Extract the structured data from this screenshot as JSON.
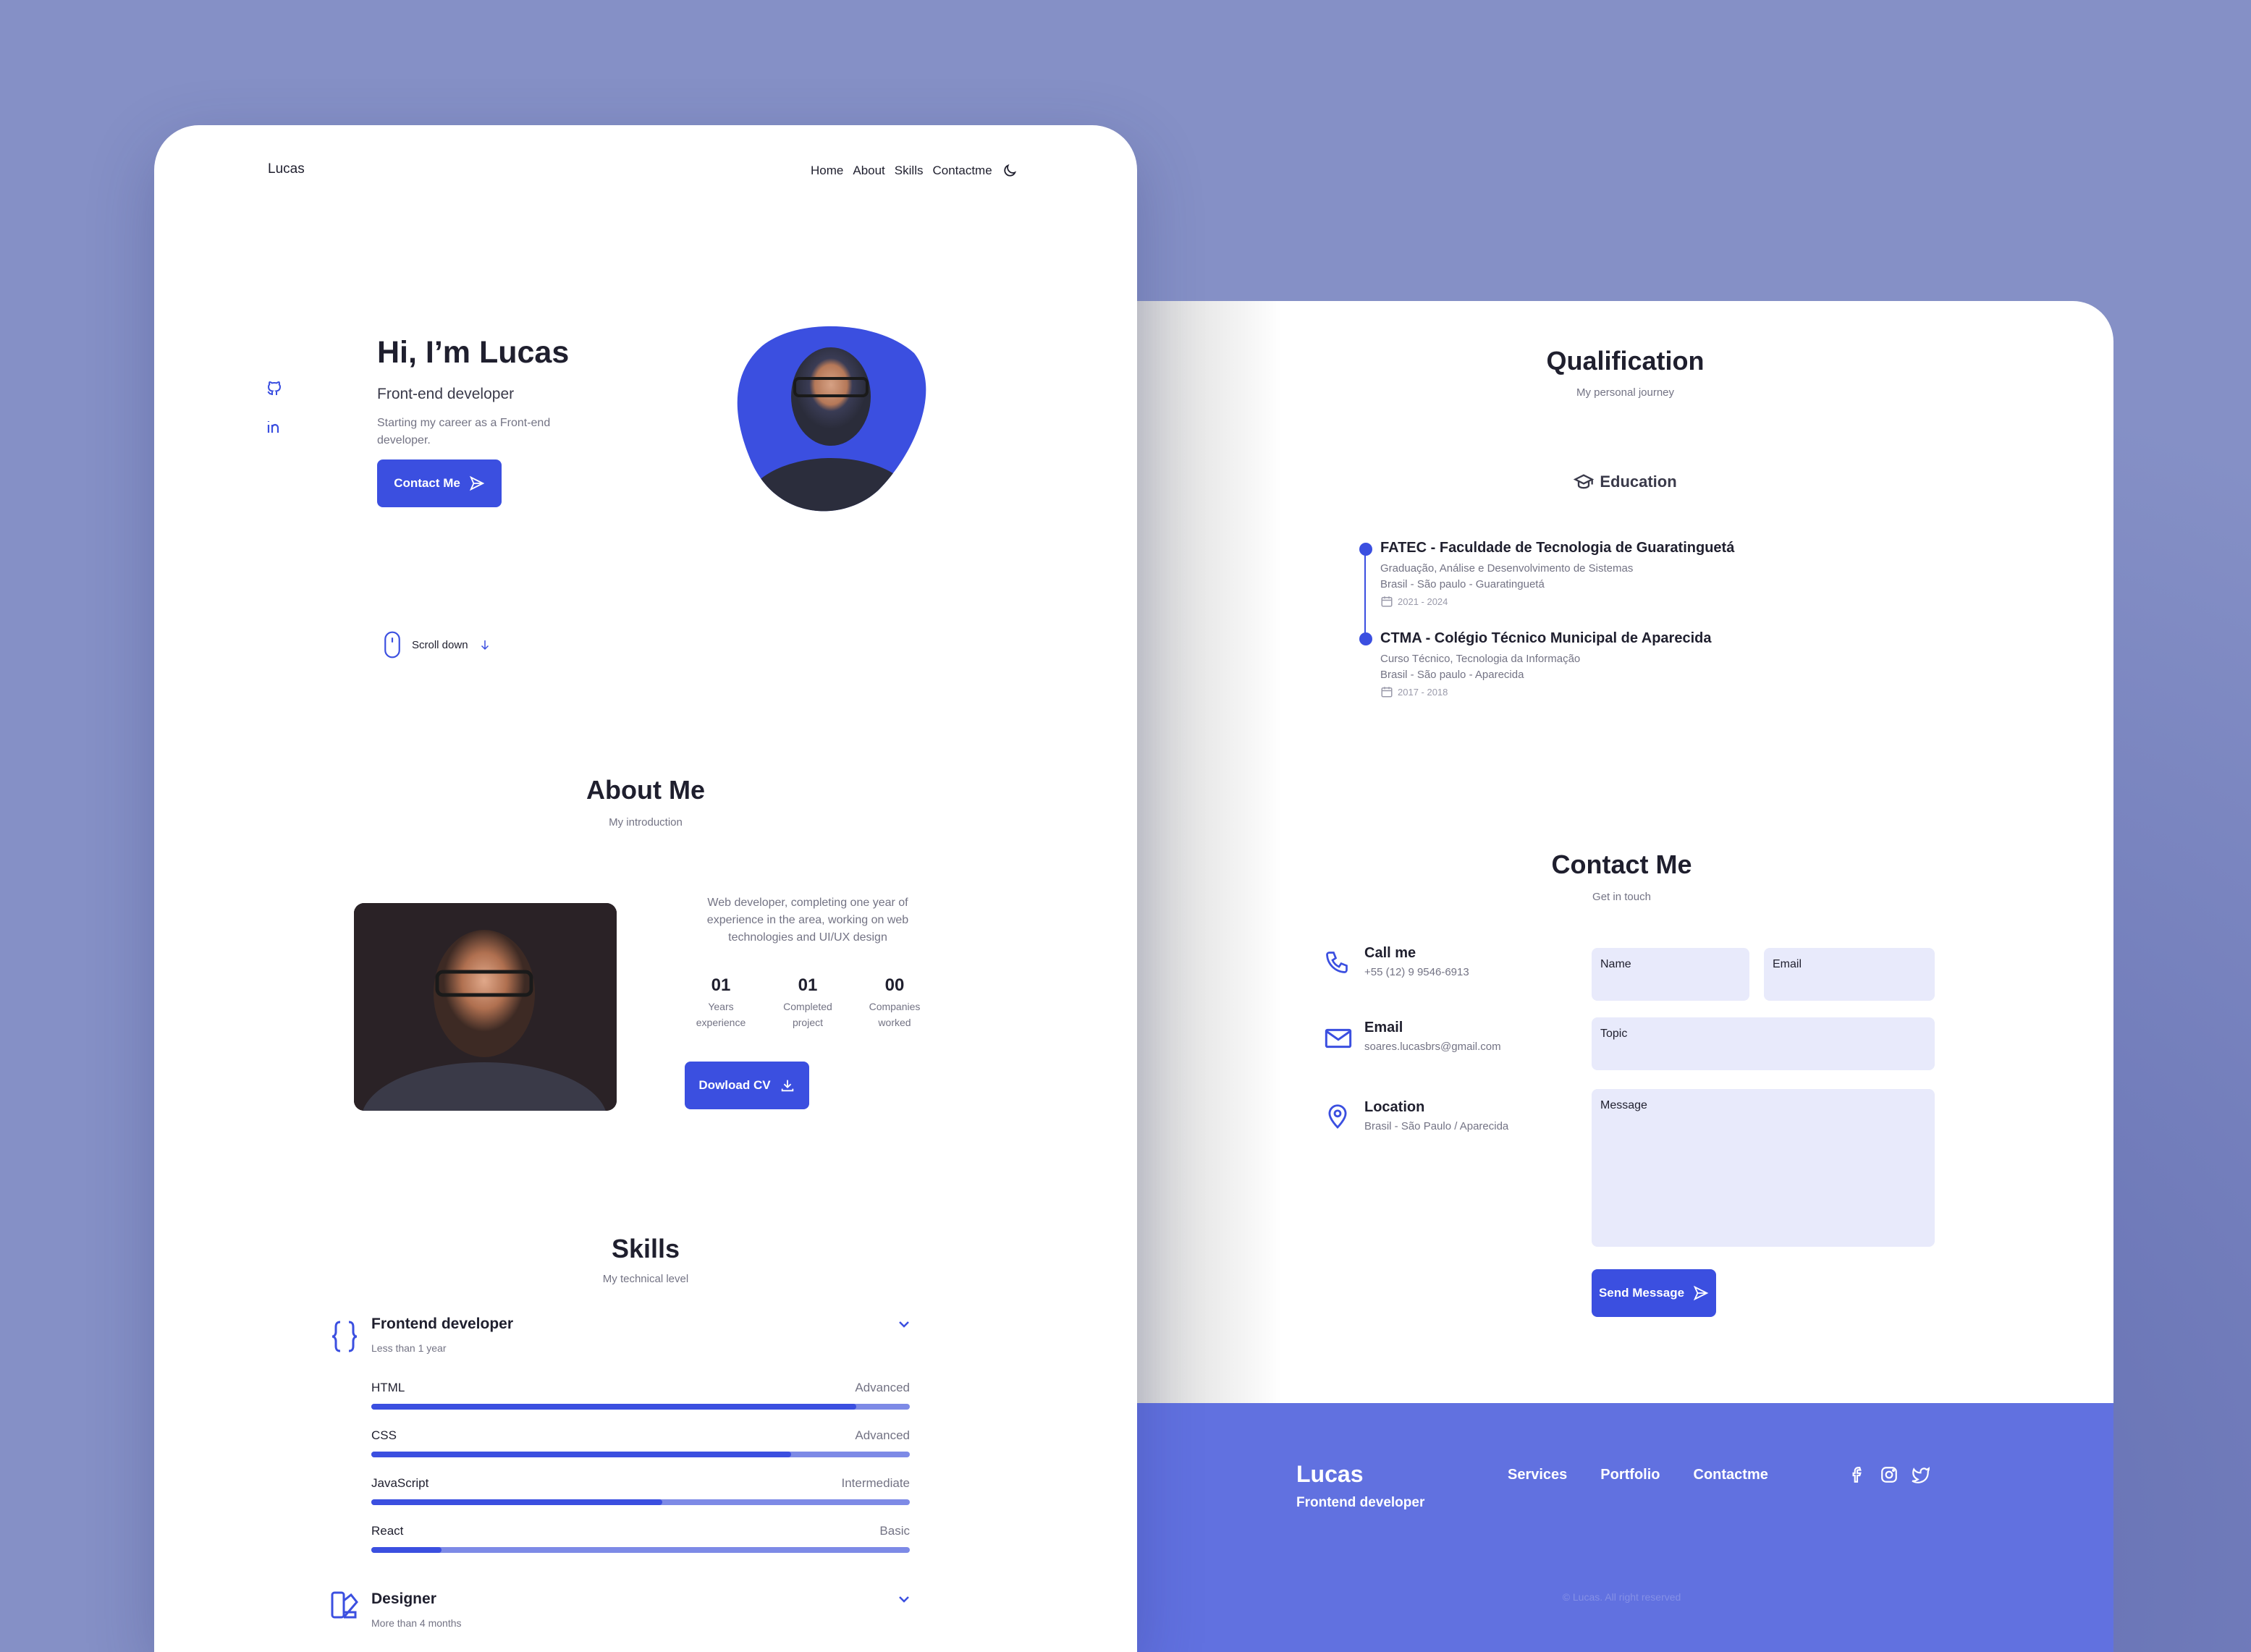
{
  "colors": {
    "accent": "#3b4fe0",
    "background": "#8590c6",
    "footer": "#6171e0",
    "input_bg": "#e8eafb"
  },
  "header": {
    "logo": "Lucas",
    "nav": [
      "Home",
      "About",
      "Skills",
      "Contactme"
    ],
    "theme_icon": "moon-icon"
  },
  "hero": {
    "title": "Hi, I’m Lucas",
    "subtitle": "Front-end developer",
    "description": "Starting my career as a Front-end developer.",
    "contact_button": "Contact Me",
    "scroll": "Scroll down",
    "social_icons": [
      "github-icon",
      "linkedin-icon"
    ]
  },
  "about": {
    "title": "About Me",
    "subtitle": "My introduction",
    "description": "Web developer, completing one year of experience in the area, working on web technologies and UI/UX design",
    "stats": [
      {
        "number": "01",
        "label1": "Years",
        "label2": "experience"
      },
      {
        "number": "01",
        "label1": "Completed",
        "label2": "project"
      },
      {
        "number": "00",
        "label1": "Companies",
        "label2": "worked"
      }
    ],
    "cv_button": "Dowload CV"
  },
  "skills": {
    "title": "Skills",
    "subtitle": "My technical level",
    "groups": [
      {
        "title": "Frontend developer",
        "subtitle": "Less than 1 year",
        "items": [
          {
            "name": "HTML",
            "level": "Advanced",
            "percent": 90
          },
          {
            "name": "CSS",
            "level": "Advanced",
            "percent": 78
          },
          {
            "name": "JavaScript",
            "level": "Intermediate",
            "percent": 54
          },
          {
            "name": "React",
            "level": "Basic",
            "percent": 13
          }
        ]
      },
      {
        "title": "Designer",
        "subtitle": "More than 4 months"
      }
    ]
  },
  "qualification": {
    "title": "Qualification",
    "subtitle": "My personal journey",
    "tab": "Education",
    "items": [
      {
        "title": "FATEC - Faculdade de Tecnologia de Guaratinguetá",
        "course": "Graduação, Análise e Desenvolvimento de Sistemas",
        "place": "Brasil - São paulo - Guaratinguetá",
        "dates": "2021 - 2024"
      },
      {
        "title": "CTMA - Colégio Técnico Municipal de Aparecida",
        "course": "Curso Técnico, Tecnologia da Informação",
        "place": "Brasil - São paulo - Aparecida",
        "dates": "2017 - 2018"
      }
    ]
  },
  "contact": {
    "title": "Contact Me",
    "subtitle": "Get in touch",
    "info": [
      {
        "label": "Call me",
        "value": "+55 (12) 9 9546-6913"
      },
      {
        "label": "Email",
        "value": "soares.lucasbrs@gmail.com"
      },
      {
        "label": "Location",
        "value": "Brasil - São Paulo / Aparecida"
      }
    ],
    "fields": {
      "name": "Name",
      "email": "Email",
      "topic": "Topic",
      "message": "Message"
    },
    "send_button": "Send Message"
  },
  "footer": {
    "logo": "Lucas",
    "role": "Frontend developer",
    "links": [
      "Services",
      "Portfolio",
      "Contactme"
    ],
    "social_icons": [
      "facebook-icon",
      "instagram-icon",
      "twitter-icon"
    ],
    "copyright": "© Lucas. All right reserved"
  }
}
